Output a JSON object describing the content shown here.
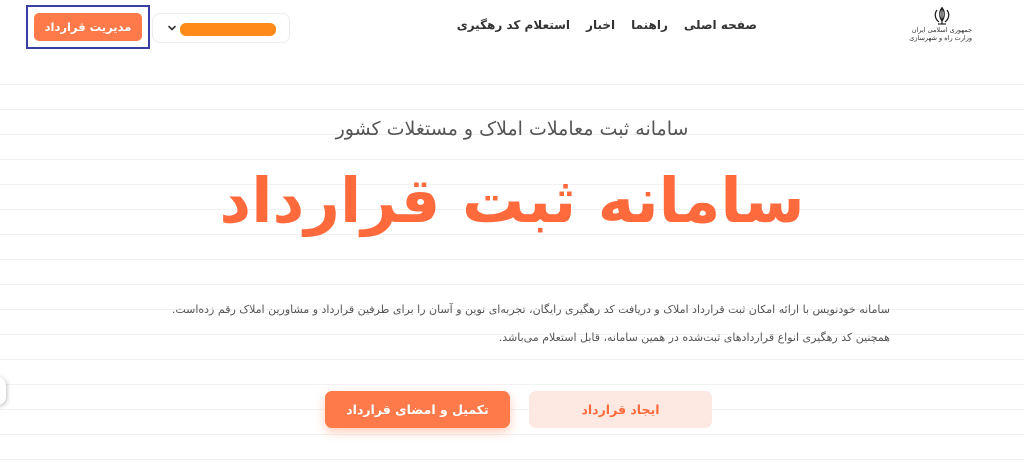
{
  "header": {
    "logo": {
      "icon": "iran-emblem-icon",
      "line1": "جمهوری اسلامی ایران",
      "line2": "وزارت راه و شهرسازی"
    },
    "nav": [
      "صفحه اصلی",
      "راهنما",
      "اخبار",
      "استعلام کد رهگیری"
    ],
    "dropdown": {
      "icon": "chevron-down-icon",
      "value": ""
    },
    "manage_button": "مدیریت قرارداد"
  },
  "hero": {
    "subtitle": "سامانه ثبت معاملات املاک و مستغلات کشور",
    "title": "سامانه ثبت قرارداد",
    "description": "سامانه خودنویس با ارائه امکان ثبت قرارداد املاک و دریافت کد رهگیری رایگان، تجربه‌ای نوین و آسان را برای طرفین قرارداد و مشاورین املاک رقم زده‌است. همچنین کد رهگیری انواع قراردادهای ثبت‌شده در همین سامانه، قابل استعلام می‌باشد.",
    "create_button": "ایجاد قرارداد",
    "complete_button": "تکمیل و امضای قرارداد"
  },
  "colors": {
    "accent": "#ff6a3c",
    "button": "#ff7a4a",
    "button_light": "#fde8e2",
    "redacted": "#ff8a1a",
    "highlight_border": "#3a3fa3"
  }
}
